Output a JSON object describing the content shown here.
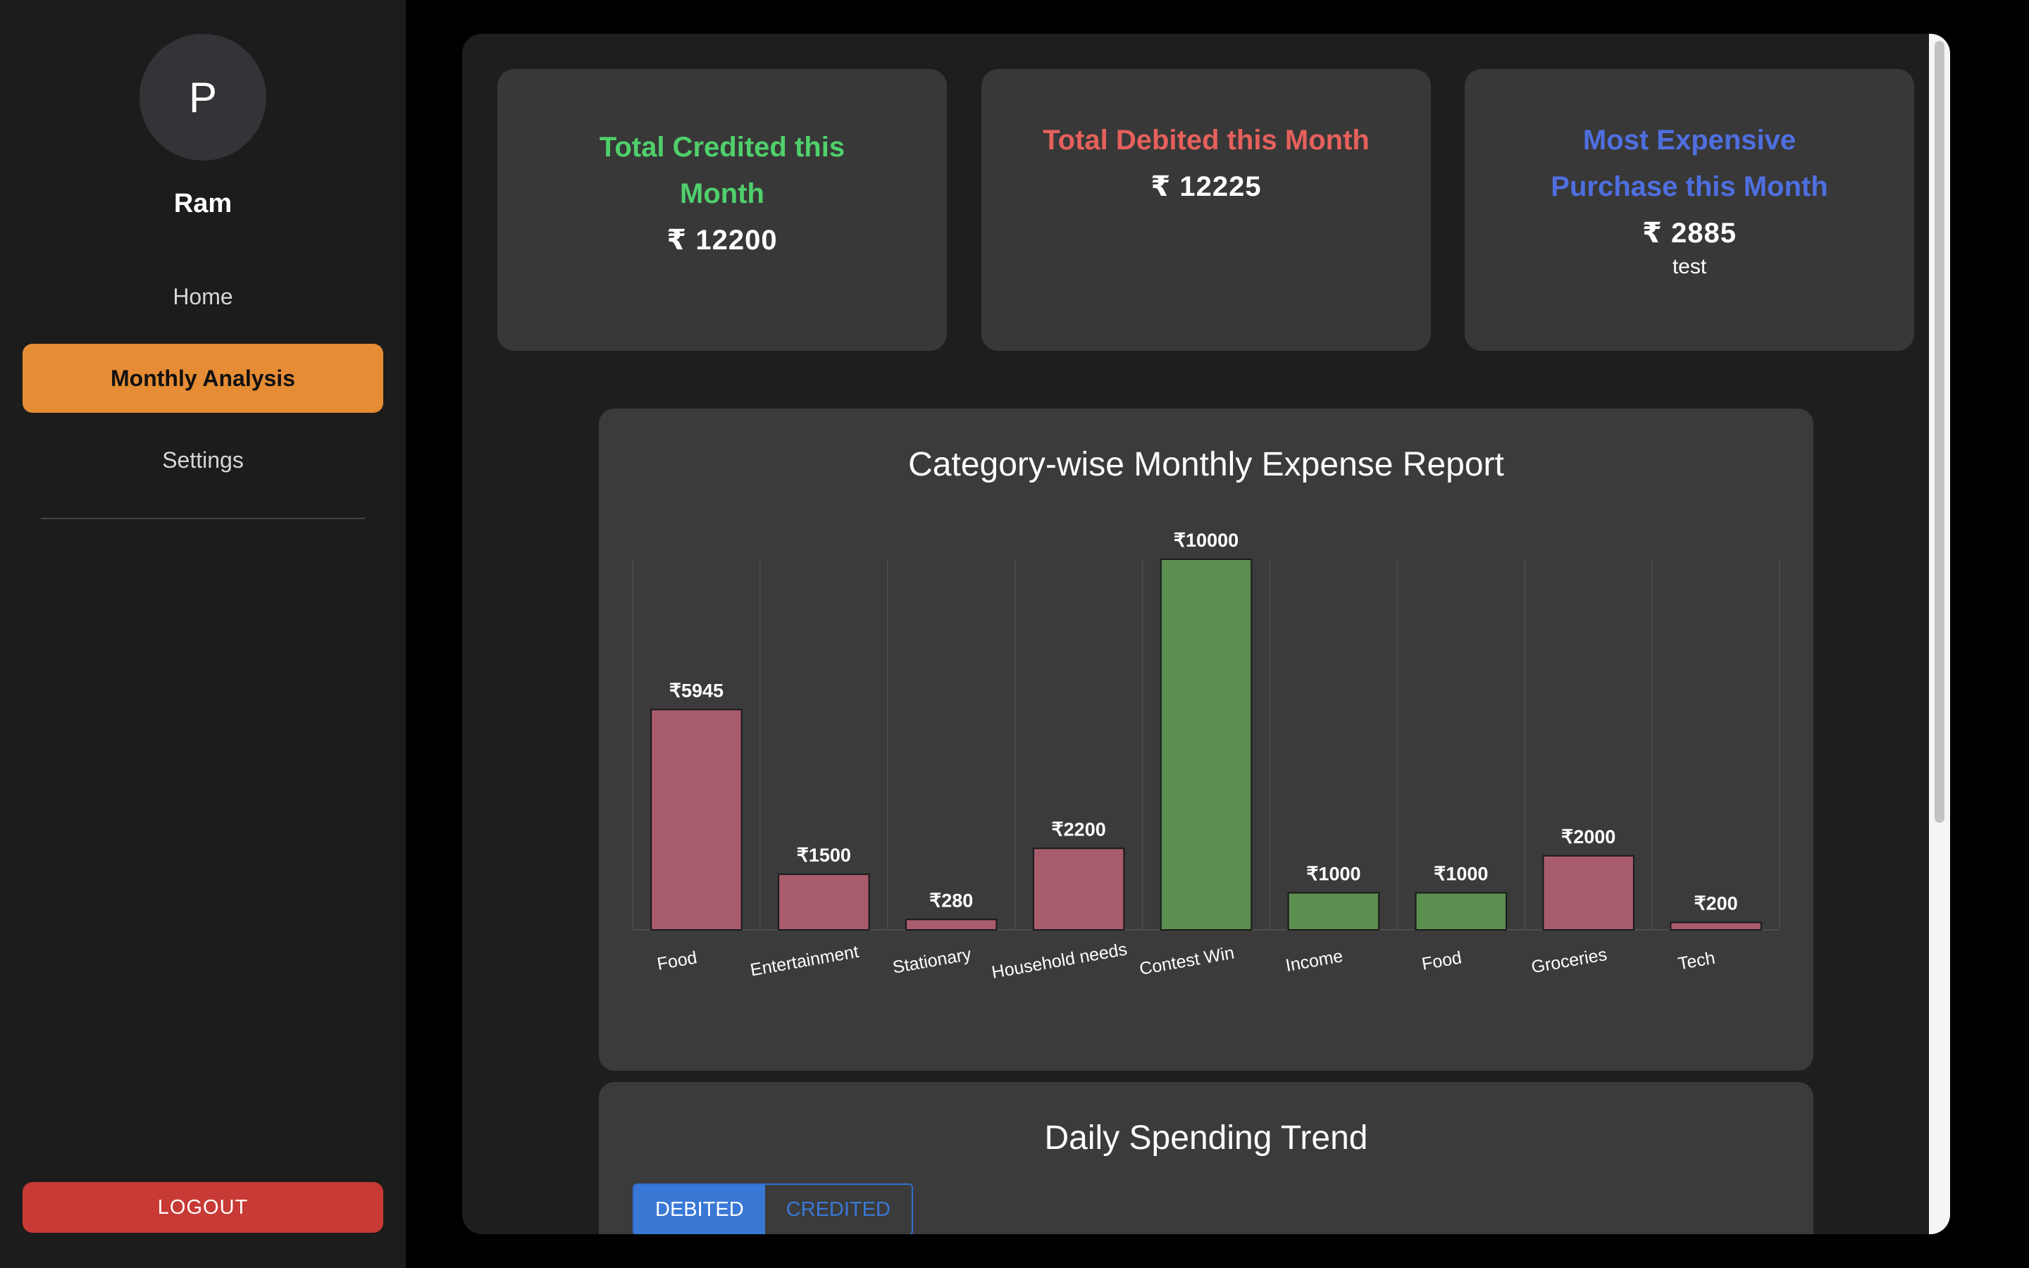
{
  "sidebar": {
    "avatar_initial": "P",
    "username": "Ram",
    "nav": {
      "home": "Home",
      "monthly_analysis": "Monthly Analysis",
      "settings": "Settings"
    },
    "logout": "LOGOUT"
  },
  "cards": {
    "credited": {
      "title": "Total Credited this Month",
      "value": "₹ 12200",
      "color": "#4fd06b"
    },
    "debited": {
      "title": "Total Debited this Month",
      "value": "₹ 12225",
      "color": "#e6605c"
    },
    "expensive": {
      "title": "Most Expensive Purchase this Month",
      "value": "₹ 2885",
      "item": "test",
      "color": "#4f6fe0"
    }
  },
  "chart_panel": {
    "title": "Category-wise Monthly Expense Report"
  },
  "chart_data": {
    "type": "bar",
    "categories": [
      "Food",
      "Entertainment",
      "Stationary",
      "Household needs",
      "Contest Win",
      "Income",
      "Food",
      "Groceries",
      "Tech"
    ],
    "values": [
      5945,
      1500,
      280,
      2200,
      10000,
      1000,
      1000,
      2000,
      200
    ],
    "data_labels": [
      "₹5945",
      "₹1500",
      "₹280",
      "₹2200",
      "₹10000",
      "₹1000",
      "₹1000",
      "₹2000",
      "₹200"
    ],
    "bar_kind": [
      "debited",
      "debited",
      "debited",
      "debited",
      "credited",
      "credited",
      "credited",
      "debited",
      "debited"
    ],
    "colors": {
      "debited": "#a85c6c",
      "credited": "#5b8f50"
    },
    "ylim": [
      0,
      10000
    ],
    "grid": "vertical",
    "legend": "none"
  },
  "trend_panel": {
    "title": "Daily Spending Trend",
    "toggle": {
      "debited": "DEBITED",
      "credited": "CREDITED",
      "selected": "DEBITED"
    }
  }
}
